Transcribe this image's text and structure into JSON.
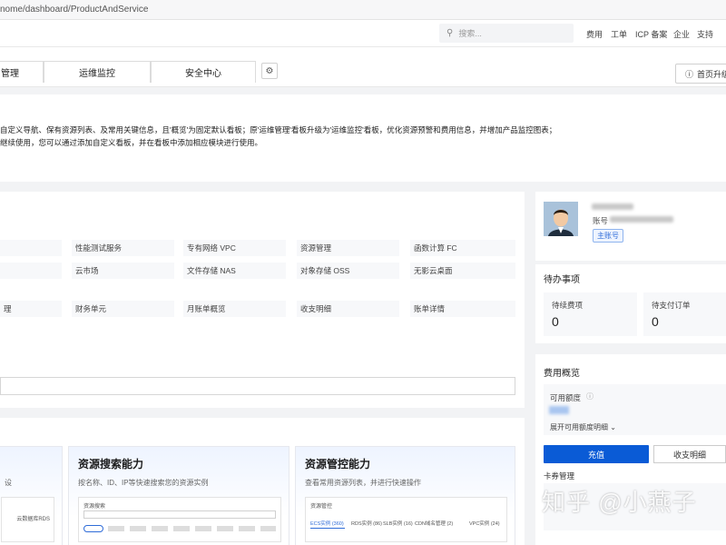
{
  "browser": {
    "url": "nome/dashboard/ProductAndService"
  },
  "topbar": {
    "search_placeholder": "搜索...",
    "nav": [
      "费用",
      "工单",
      "ICP 备案",
      "企业",
      "支持"
    ]
  },
  "tabs": {
    "items": [
      "管理",
      "运维监控",
      "安全中心"
    ],
    "home_button": "首页升级"
  },
  "notice": {
    "line1": "自定义导航、保有资源列表、及常用关键信息，且'概览'为固定默认看板；原'运维管理'看板升级为'运维监控'看板，优化资源预警和费用信息，并增加产品监控图表；",
    "line2": "继续使用，您可以通过添加自定义看板，并在看板中添加相应模块进行使用。"
  },
  "shortcuts": {
    "row1": [
      "性能测试服务",
      "专有网络 VPC",
      "资源管理",
      "函数计算 FC"
    ],
    "row2": [
      "云市场",
      "文件存储 NAS",
      "对象存储 OSS",
      "无影云桌面"
    ],
    "row3": [
      "理",
      "财务单元",
      "月账单概览",
      "收支明细",
      "账单详情"
    ]
  },
  "capabilities": [
    {
      "title": "",
      "desc": "设"
    },
    {
      "title": "资源搜索能力",
      "desc": "按名称、ID、IP等快速搜索您的资源实例"
    },
    {
      "title": "资源管控能力",
      "desc": "查看常用资源列表，并进行快速操作"
    }
  ],
  "mini_tabs": [
    "ECS实例 (360)",
    "RDS实例 (86)",
    "SLB实例 (16)",
    "CDN域名管理 (2)",
    "VPC实例 (24)"
  ],
  "mini_label": "资源管控",
  "mini_search_label": "资源搜索",
  "mini_left_label": "云数据库RDS",
  "account": {
    "account_prefix": "账号",
    "tag": "主账号"
  },
  "todos": {
    "title": "待办事项",
    "items": [
      {
        "label": "待续费项",
        "value": "0"
      },
      {
        "label": "待支付订单",
        "value": "0"
      }
    ]
  },
  "billing": {
    "title": "费用概览",
    "available_label": "可用额度",
    "expand_label": "展开可用额度明细",
    "recharge": "充值",
    "details": "收支明细",
    "voucher_label": "卡券管理"
  },
  "watermark": "知乎 @小燕子"
}
